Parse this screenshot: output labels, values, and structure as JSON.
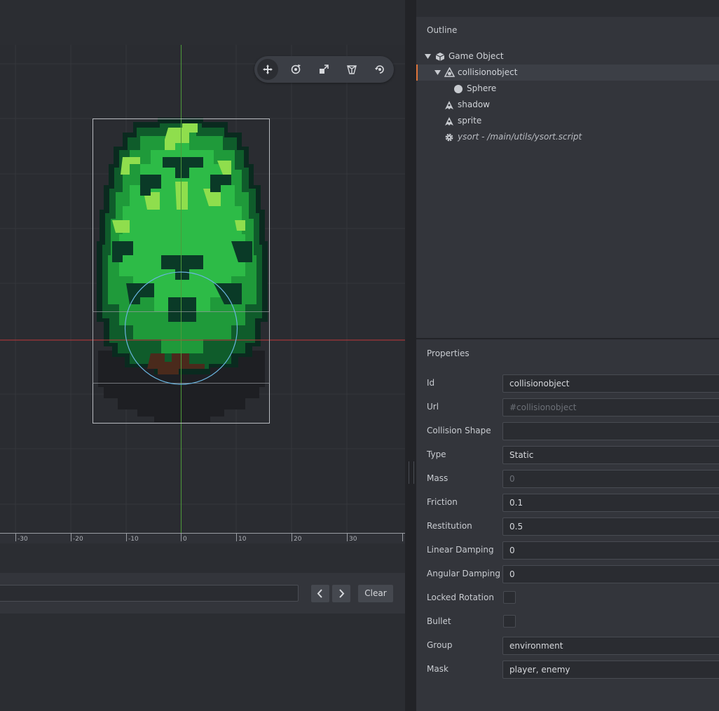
{
  "outline": {
    "title": "Outline",
    "items": [
      {
        "label": "Game Object",
        "icon": "cube-icon",
        "expanded": true
      },
      {
        "label": "collisionobject",
        "icon": "collision-object-icon",
        "expanded": true,
        "selected": true
      },
      {
        "label": "Sphere",
        "icon": "sphere-icon"
      },
      {
        "label": "shadow",
        "icon": "sprite-icon"
      },
      {
        "label": "sprite",
        "icon": "sprite-icon"
      },
      {
        "label": "ysort - /main/utils/ysort.script",
        "icon": "gear-icon"
      }
    ]
  },
  "properties": {
    "title": "Properties",
    "rows": [
      {
        "label": "Id",
        "value": "collisionobject",
        "kind": "text"
      },
      {
        "label": "Url",
        "value": "#collisionobject",
        "kind": "text",
        "disabled": true
      },
      {
        "label": "Collision Shape",
        "value": "",
        "kind": "text"
      },
      {
        "label": "Type",
        "value": "Static",
        "kind": "select"
      },
      {
        "label": "Mass",
        "value": "0",
        "kind": "text",
        "disabled": true
      },
      {
        "label": "Friction",
        "value": "0.1",
        "kind": "text"
      },
      {
        "label": "Restitution",
        "value": "0.5",
        "kind": "text"
      },
      {
        "label": "Linear Damping",
        "value": "0",
        "kind": "text"
      },
      {
        "label": "Angular Damping",
        "value": "0",
        "kind": "text"
      },
      {
        "label": "Locked Rotation",
        "checked": false,
        "kind": "checkbox"
      },
      {
        "label": "Bullet",
        "checked": false,
        "kind": "checkbox"
      },
      {
        "label": "Group",
        "value": "environment",
        "kind": "text"
      },
      {
        "label": "Mask",
        "value": "player, enemy",
        "kind": "text"
      }
    ]
  },
  "viewport": {
    "tools": [
      "move-tool-icon",
      "rotate-tool-icon",
      "scale-tool-icon",
      "perspective-tool-icon",
      "reset-camera-icon"
    ],
    "active_tool": "move-tool-icon",
    "ruler_ticks": [
      "-30",
      "-20",
      "-10",
      "0",
      "10",
      "20",
      "30"
    ]
  },
  "console": {
    "search_value": "",
    "prev_icon": "chevron-left-icon",
    "next_icon": "chevron-right-icon",
    "clear_label": "Clear"
  },
  "colors": {
    "selection_accent": "#e0753a",
    "axis_x": "#c0393b",
    "axis_y": "#4e9a3a",
    "collision_shape": "#6ab5e0"
  }
}
